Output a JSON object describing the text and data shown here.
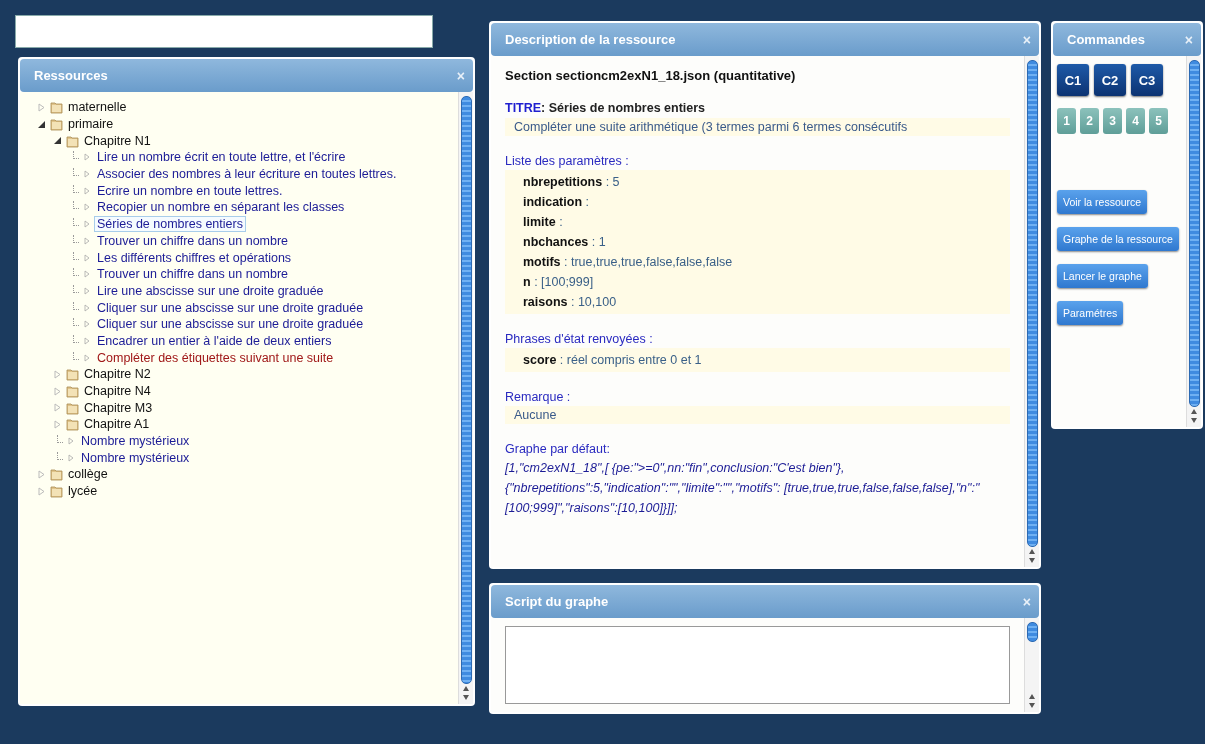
{
  "resources": {
    "title": "Ressources",
    "close": "×",
    "tree": [
      {
        "kind": "folder",
        "label": "maternelle",
        "expanded": false
      },
      {
        "kind": "folder",
        "label": "primaire",
        "expanded": true,
        "children": [
          {
            "kind": "folder",
            "label": "Chapitre N1",
            "expanded": true,
            "children": [
              {
                "kind": "resource",
                "label": "Lire un nombre écrit en toute lettre, et l'écrire",
                "selected": false,
                "color": "#1c1c96"
              },
              {
                "kind": "resource",
                "label": "Associer des nombres à leur écriture en toutes lettres.",
                "selected": false,
                "color": "#1c1c96"
              },
              {
                "kind": "resource",
                "label": "Ecrire un nombre en toute lettres.",
                "selected": false,
                "color": "#1c1c96"
              },
              {
                "kind": "resource",
                "label": "Recopier un nombre en séparant les classes",
                "selected": false,
                "color": "#1c1c96"
              },
              {
                "kind": "resource",
                "label": "Séries de nombres entiers",
                "selected": true,
                "color": "#1c1c96"
              },
              {
                "kind": "resource",
                "label": "Trouver un chiffre dans un nombre",
                "selected": false,
                "color": "#1c1c96"
              },
              {
                "kind": "resource",
                "label": "Les différents chiffres et opérations",
                "selected": false,
                "color": "#1c1c96"
              },
              {
                "kind": "resource",
                "label": "Trouver un chiffre dans un nombre",
                "selected": false,
                "color": "#1c1c96"
              },
              {
                "kind": "resource",
                "label": "Lire une abscisse sur une droite graduée",
                "selected": false,
                "color": "#1c1c96"
              },
              {
                "kind": "resource",
                "label": "Cliquer sur une abscisse sur une droite graduée",
                "selected": false,
                "color": "#1c1c96"
              },
              {
                "kind": "resource",
                "label": "Cliquer sur une abscisse sur une droite graduée",
                "selected": false,
                "color": "#1c1c96"
              },
              {
                "kind": "resource",
                "label": "Encadrer un entier à l'aide de deux entiers",
                "selected": false,
                "color": "#1c1c96"
              },
              {
                "kind": "resource",
                "label": "Compléter des étiquettes suivant une suite",
                "selected": false,
                "color": "#a01818"
              }
            ]
          },
          {
            "kind": "folder",
            "label": "Chapitre N2",
            "expanded": false
          },
          {
            "kind": "folder",
            "label": "Chapitre N4",
            "expanded": false
          },
          {
            "kind": "folder",
            "label": "Chapitre M3",
            "expanded": false
          },
          {
            "kind": "folder",
            "label": "Chapitre A1",
            "expanded": false
          },
          {
            "kind": "resource",
            "label": "Nombre mystérieux",
            "selected": false,
            "color": "#1c1c96"
          },
          {
            "kind": "resource",
            "label": "Nombre mystérieux",
            "selected": false,
            "color": "#1c1c96"
          }
        ]
      },
      {
        "kind": "folder",
        "label": "collège",
        "expanded": false
      },
      {
        "kind": "folder",
        "label": "lycée",
        "expanded": false
      }
    ]
  },
  "description": {
    "title": "Description de la ressource",
    "close": "×",
    "section": "Section sectioncm2exN1_18.json (quantitative)",
    "titre_label": "TITRE",
    "titre": ": Séries de nombres entiers",
    "summary": "Compléter une suite arithmétique (3 termes parmi 6 termes consécutifs",
    "params_label": "Liste des paramètres :",
    "params": [
      {
        "name": "nbrepetitions",
        "value": ": 5"
      },
      {
        "name": "indication",
        "value": ":"
      },
      {
        "name": "limite",
        "value": ":"
      },
      {
        "name": "nbchances",
        "value": ": 1"
      },
      {
        "name": "motifs",
        "value": ": true,true,true,false,false,false"
      },
      {
        "name": "n",
        "value": ": [100;999]"
      },
      {
        "name": "raisons",
        "value": ": 10,100"
      }
    ],
    "states_label": "Phrases d'état renvoyées :",
    "states": [
      {
        "name": "score",
        "value": ": réel compris entre 0 et 1"
      }
    ],
    "remark_label": "Remarque :",
    "remark": "Aucune",
    "graph_label": "Graphe par défaut:",
    "graph": "[1,\"cm2exN1_18\",[ {pe:\">=0\",nn:\"fin\",conclusion:\"C'est bien\"}, {\"nbrepetitions\":5,\"indication\":\"\",\"limite\":\"\",\"motifs\": [true,true,true,false,false,false],\"n\":\"[100;999]\",\"raisons\":[10,100]}]];"
  },
  "script": {
    "title": "Script du graphe",
    "close": "×"
  },
  "commands": {
    "title": "Commandes",
    "close": "×",
    "chapters": [
      "C1",
      "C2",
      "C3"
    ],
    "numbers": [
      "1",
      "2",
      "3",
      "4",
      "5"
    ],
    "actions": [
      "Voir la ressource",
      "Graphe de la ressource",
      "Lancer le graphe",
      "Paramétres"
    ]
  }
}
